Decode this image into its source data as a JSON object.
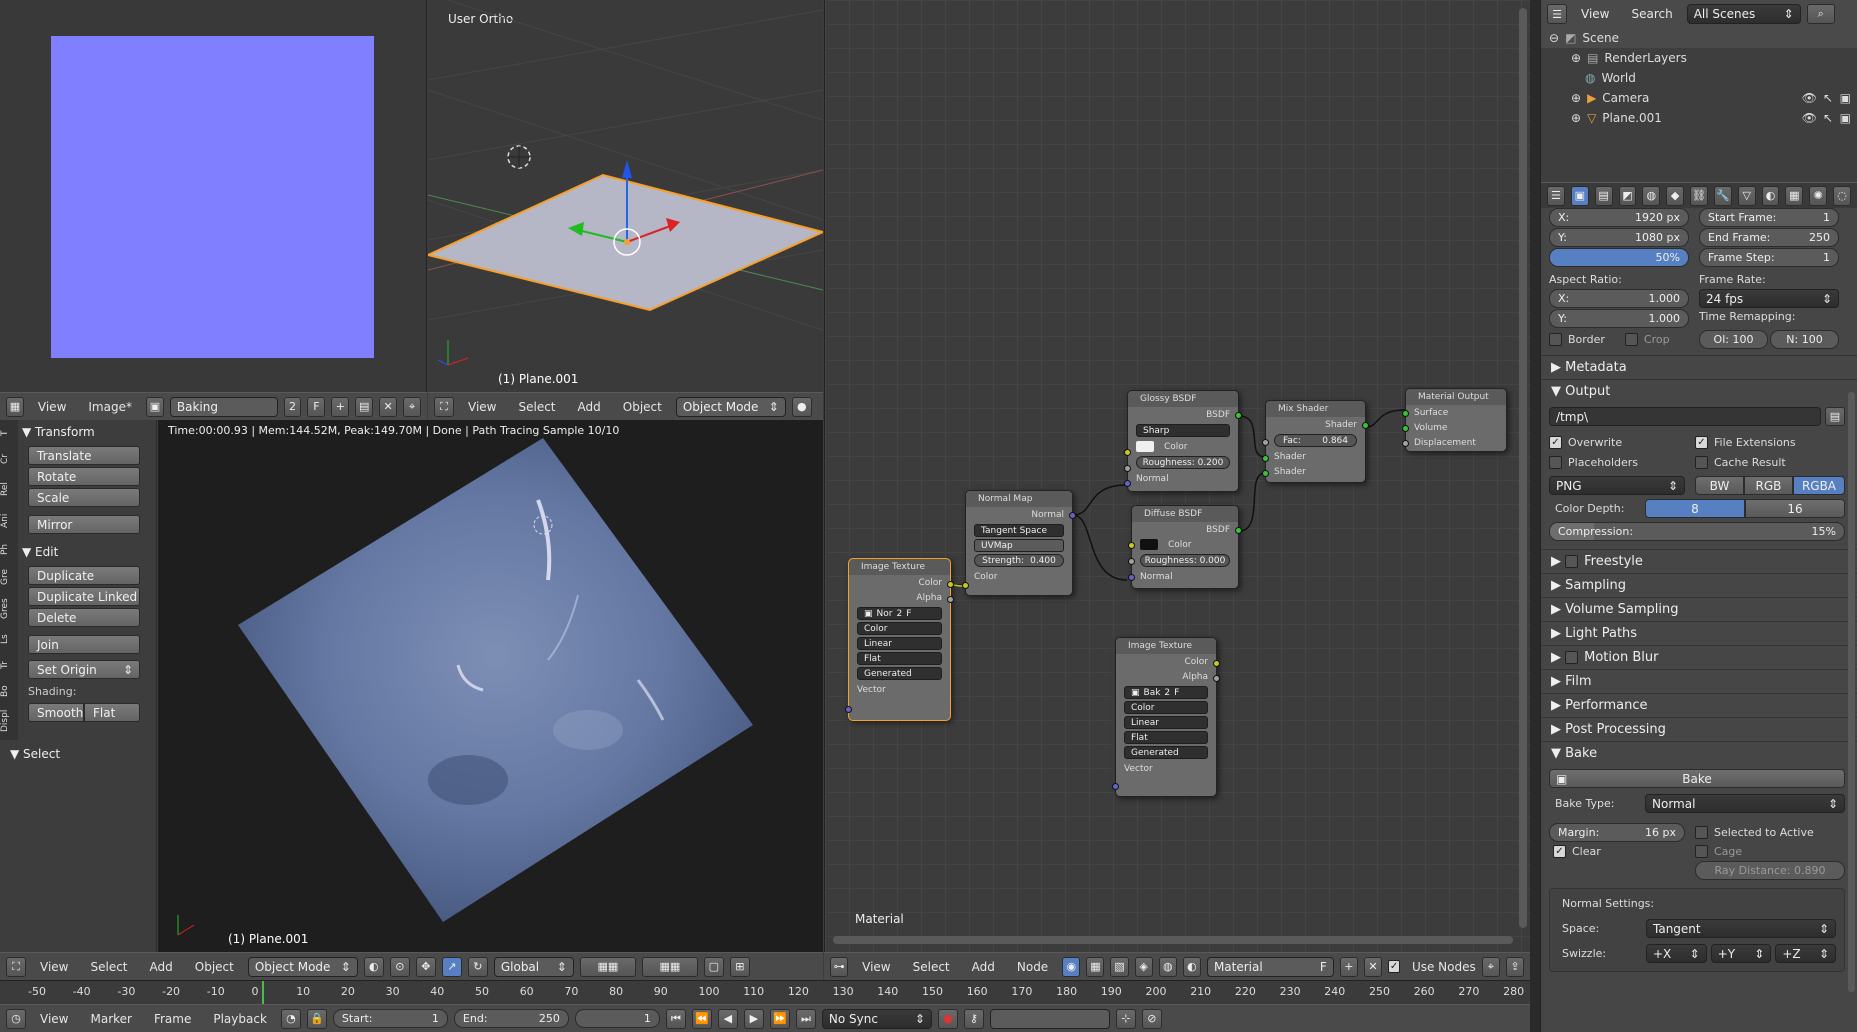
{
  "colors": {
    "accent": "#5680c2",
    "uv_blue": "#7f7fff",
    "selected": "#f89f28"
  },
  "image_editor": {
    "header": {
      "menus": [
        "View",
        "Image*"
      ],
      "image_name": "Baking",
      "users": "2",
      "fake": "F"
    }
  },
  "viewport_top": {
    "label": "User Ortho",
    "object": "(1) Plane.001",
    "header": {
      "menus": [
        "View",
        "Select",
        "Add",
        "Object"
      ],
      "mode": "Object Mode"
    }
  },
  "viewport_render": {
    "status": "Time:00:00.93 | Mem:144.52M, Peak:149.70M | Done | Path Tracing Sample 10/10",
    "object": "(1) Plane.001"
  },
  "toolshelf": {
    "tabs": [
      "T",
      "Cr",
      "Rel",
      "Ani",
      "Ph",
      "Gre",
      "Gres",
      "Ls",
      "Tr",
      "Bo",
      "Displ"
    ],
    "transform_title": "Transform",
    "transform": [
      "Translate",
      "Rotate",
      "Scale",
      "Mirror"
    ],
    "edit_title": "Edit",
    "edit": [
      "Duplicate",
      "Duplicate Linked",
      "Delete",
      "Join",
      "Set Origin"
    ],
    "shading_label": "Shading:",
    "smooth": "Smooth",
    "flat": "Flat",
    "select_title": "Select"
  },
  "view3d_header": {
    "menus": [
      "View",
      "Select",
      "Add",
      "Object"
    ],
    "mode": "Object Mode",
    "orientation": "Global"
  },
  "nodes": {
    "label": "Material",
    "header": {
      "menus": [
        "View",
        "Select",
        "Add",
        "Node"
      ],
      "material": "Material",
      "fake": "F",
      "use_nodes": "Use Nodes"
    },
    "image_texture1": {
      "title": "Image Texture",
      "outputs": [
        "Color",
        "Alpha"
      ],
      "img": "Nor",
      "users": "2",
      "fake": "F",
      "color": "Color",
      "interp": "Linear",
      "proj": "Flat",
      "ext": "Generated",
      "input": "Vector"
    },
    "normal_map": {
      "title": "Normal Map",
      "output": "Normal",
      "space": "Tangent Space",
      "uv": "UVMap",
      "strength_label": "Strength:",
      "strength": "0.400",
      "input": "Color"
    },
    "glossy": {
      "title": "Glossy BSDF",
      "output": "BSDF",
      "dist": "Sharp",
      "color": "Color",
      "roughness": "Roughness: 0.200",
      "normal": "Normal"
    },
    "diffuse": {
      "title": "Diffuse BSDF",
      "output": "BSDF",
      "color": "Color",
      "roughness": "Roughness: 0.000",
      "normal": "Normal"
    },
    "mix": {
      "title": "Mix Shader",
      "output": "Shader",
      "fac_label": "Fac:",
      "fac": "0.864",
      "in1": "Shader",
      "in2": "Shader"
    },
    "output": {
      "title": "Material Output",
      "inputs": [
        "Surface",
        "Volume",
        "Displacement"
      ]
    },
    "image_texture2": {
      "title": "Image Texture",
      "outputs": [
        "Color",
        "Alpha"
      ],
      "img": "Bak",
      "users": "2",
      "fake": "F",
      "color": "Color",
      "interp": "Linear",
      "proj": "Flat",
      "ext": "Generated",
      "input": "Vector"
    }
  },
  "outliner": {
    "menus": [
      "View",
      "Search"
    ],
    "scenes": "All Scenes",
    "items": [
      "Scene",
      "RenderLayers",
      "World",
      "Camera",
      "Plane.001"
    ]
  },
  "properties": {
    "res": {
      "x_label": "X:",
      "x": "1920 px",
      "y_label": "Y:",
      "y": "1080 px",
      "pct": "50%",
      "start_label": "Start Frame:",
      "start": "1",
      "end_label": "End Frame:",
      "end": "250",
      "step_label": "Frame Step:",
      "step": "1"
    },
    "aspect_label": "Aspect Ratio:",
    "ax_label": "X:",
    "ax": "1.000",
    "ay_label": "Y:",
    "ay": "1.000",
    "framerate_label": "Frame Rate:",
    "framerate": "24 fps",
    "remap_label": "Time Remapping:",
    "remap_old": "Ol: 100",
    "remap_new": "N: 100",
    "border": "Border",
    "crop": "Crop",
    "metadata": "Metadata",
    "output": "Output",
    "path": "/tmp\\",
    "overwrite": "Overwrite",
    "file_ext": "File Extensions",
    "placeholders": "Placeholders",
    "cache": "Cache Result",
    "format": "PNG",
    "bw": "BW",
    "rgb": "RGB",
    "rgba": "RGBA",
    "depth_label": "Color Depth:",
    "depth8": "8",
    "depth16": "16",
    "compression_label": "Compression:",
    "compression": "15%",
    "compression_value": 0.15,
    "panels": [
      "Freestyle",
      "Sampling",
      "Volume Sampling",
      "Light Paths",
      "Motion Blur",
      "Film",
      "Performance",
      "Post Processing"
    ],
    "bake_title": "Bake",
    "bake_button": "Bake",
    "bake_type_label": "Bake Type:",
    "bake_type": "Normal",
    "margin_label": "Margin:",
    "margin": "16 px",
    "selected_to_active": "Selected to Active",
    "clear": "Clear",
    "cage": "Cage",
    "ray_distance": "Ray Distance: 0.890",
    "normal_settings": "Normal Settings:",
    "space_label": "Space:",
    "space": "Tangent",
    "swizzle_label": "Swizzle:",
    "sx": "+X",
    "sy": "+Y",
    "sz": "+Z"
  },
  "timeline": {
    "ticks": [
      "-50",
      "-40",
      "-30",
      "-20",
      "-10",
      "0",
      "10",
      "20",
      "30",
      "40",
      "50",
      "60",
      "70",
      "80",
      "90",
      "100",
      "110",
      "120",
      "130",
      "140",
      "150",
      "160",
      "170",
      "180",
      "190",
      "200",
      "210",
      "220",
      "230",
      "240",
      "250",
      "260",
      "270",
      "280"
    ],
    "menus": [
      "View",
      "Marker",
      "Frame",
      "Playback"
    ],
    "start_label": "Start:",
    "start": "1",
    "end_label": "End:",
    "end": "250",
    "current": "1",
    "sync": "No Sync"
  }
}
